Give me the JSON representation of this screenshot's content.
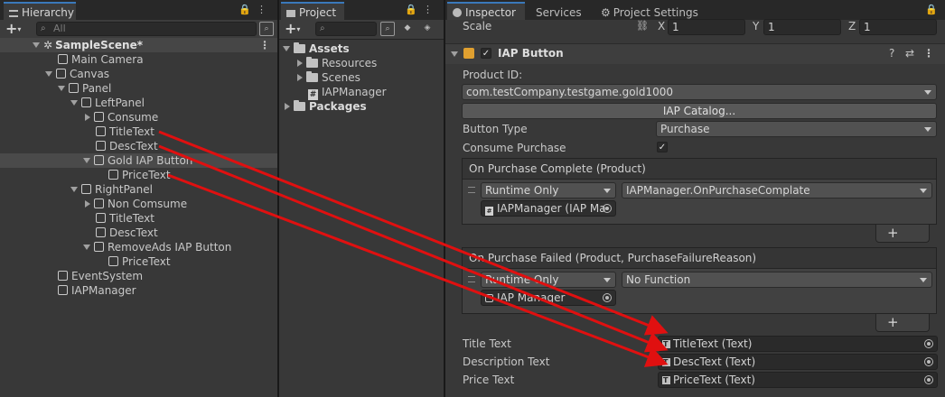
{
  "hierarchy": {
    "tab": "Hierarchy",
    "search_placeholder": "All",
    "scene": "SampleScene*",
    "items": [
      {
        "label": "Main Camera"
      },
      {
        "label": "Canvas"
      },
      {
        "label": "Panel"
      },
      {
        "label": "LeftPanel"
      },
      {
        "label": "Consume"
      },
      {
        "label": "TitleText"
      },
      {
        "label": "DescText"
      },
      {
        "label": "Gold IAP Button"
      },
      {
        "label": "PriceText"
      },
      {
        "label": "RightPanel"
      },
      {
        "label": "Non Comsume"
      },
      {
        "label": "TitleText"
      },
      {
        "label": "DescText"
      },
      {
        "label": "RemoveAds IAP Button"
      },
      {
        "label": "PriceText"
      },
      {
        "label": "EventSystem"
      },
      {
        "label": "IAPManager"
      }
    ]
  },
  "project": {
    "tab": "Project",
    "items": [
      {
        "label": "Assets"
      },
      {
        "label": "Resources"
      },
      {
        "label": "Scenes"
      },
      {
        "label": "IAPManager"
      },
      {
        "label": "Packages"
      }
    ]
  },
  "inspector": {
    "tabs": [
      "Inspector",
      "Services",
      "Project Settings"
    ],
    "scale": {
      "label": "Scale",
      "x_label": "X",
      "x": "1",
      "y_label": "Y",
      "y": "1",
      "z_label": "Z",
      "z": "1"
    },
    "component": "IAP Button",
    "product_id_label": "Product ID:",
    "product_id": "com.testCompany.testgame.gold1000",
    "catalog_button": "IAP Catalog...",
    "button_type_label": "Button Type",
    "button_type": "Purchase",
    "consume_label": "Consume Purchase",
    "consume_checked": true,
    "on_complete": {
      "title": "On Purchase Complete (Product)",
      "runtime": "Runtime Only",
      "function": "IAPManager.OnPurchaseComplate",
      "object": "IAPManager (IAP Ma"
    },
    "on_failed": {
      "title": "On Purchase Failed (Product, PurchaseFailureReason)",
      "runtime": "Runtime Only",
      "function": "No Function",
      "object": "IAP Manager"
    },
    "title_text_label": "Title Text",
    "title_text": "TitleText (Text)",
    "desc_text_label": "Description Text",
    "desc_text": "DescText (Text)",
    "price_text_label": "Price Text",
    "price_text": "PriceText (Text)"
  },
  "colors": {
    "arrow": "#e01010",
    "tab_accent": "#3a79bb"
  }
}
